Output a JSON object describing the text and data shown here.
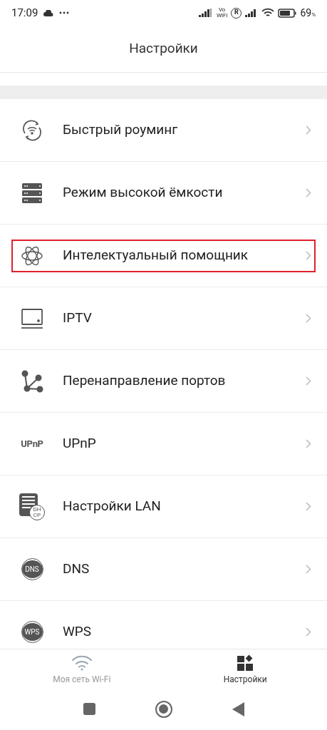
{
  "status_bar": {
    "time": "17:09",
    "volte": "Vo",
    "volte_sub": "WiFi",
    "roaming": "R",
    "battery_percent": "69",
    "percent_sign": "%"
  },
  "header": {
    "title": "Настройки"
  },
  "items": [
    {
      "kind": "roaming",
      "label": "Быстрый роуминг",
      "highlighted": false
    },
    {
      "kind": "server",
      "label": "Режим высокой ёмкости",
      "highlighted": false
    },
    {
      "kind": "atom",
      "label": "Интелектуальный помощник",
      "highlighted": true
    },
    {
      "kind": "tv",
      "label": "IPTV",
      "highlighted": false
    },
    {
      "kind": "ports",
      "label": "Перенаправление портов",
      "highlighted": false
    },
    {
      "kind": "upnp",
      "label": "UPnP",
      "icon_text": "UPnP",
      "highlighted": false
    },
    {
      "kind": "lan",
      "label": "Настройки LAN",
      "icon_text": "DHCP",
      "highlighted": false
    },
    {
      "kind": "badge",
      "label": "DNS",
      "icon_text": "DNS",
      "highlighted": false
    },
    {
      "kind": "badge",
      "label": "WPS",
      "icon_text": "WPS",
      "highlighted": false
    }
  ],
  "bottom_nav": [
    {
      "kind": "wifi",
      "label": "Моя сеть Wi-Fi",
      "selected": false
    },
    {
      "kind": "settings",
      "label": "Настройки",
      "selected": true
    }
  ]
}
